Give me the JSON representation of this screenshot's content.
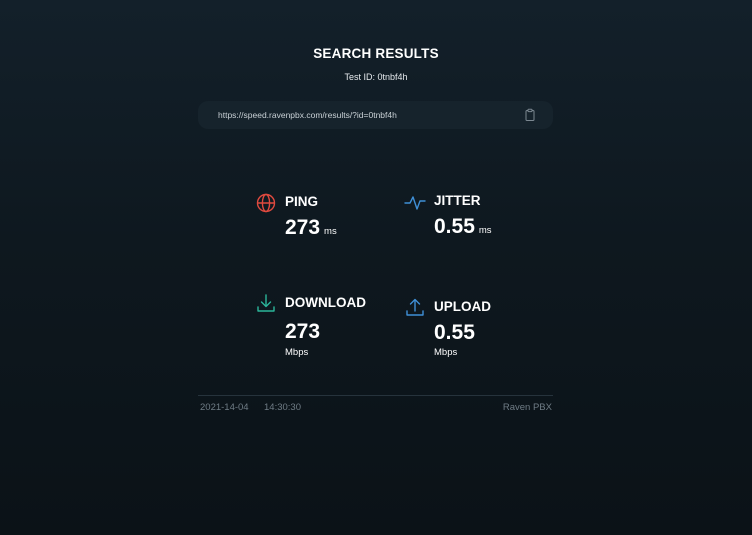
{
  "header": {
    "title": "SEARCH RESULTS",
    "test_id": "Test ID: 0tnbf4h"
  },
  "url_bar": {
    "url": "https://speed.ravenpbx.com/results/?id=0tnbf4h",
    "copy_icon": "clipboard-icon"
  },
  "metrics": {
    "ping": {
      "label": "PING",
      "value": "273",
      "unit": "ms",
      "icon": "globe-icon",
      "color": "#e04a3f"
    },
    "jitter": {
      "label": "JITTER",
      "value": "0.55",
      "unit": "ms",
      "icon": "pulse-icon",
      "color": "#3f8fd6"
    },
    "download": {
      "label": "DOWNLOAD",
      "value": "273",
      "unit": "Mbps",
      "icon": "download-icon",
      "color": "#2bb59a"
    },
    "upload": {
      "label": "UPLOAD",
      "value": "0.55",
      "unit": "Mbps",
      "icon": "upload-icon",
      "color": "#3f8fd6"
    }
  },
  "footer": {
    "date": "2021-14-04",
    "time": "14:30:30",
    "brand": "Raven PBX"
  }
}
